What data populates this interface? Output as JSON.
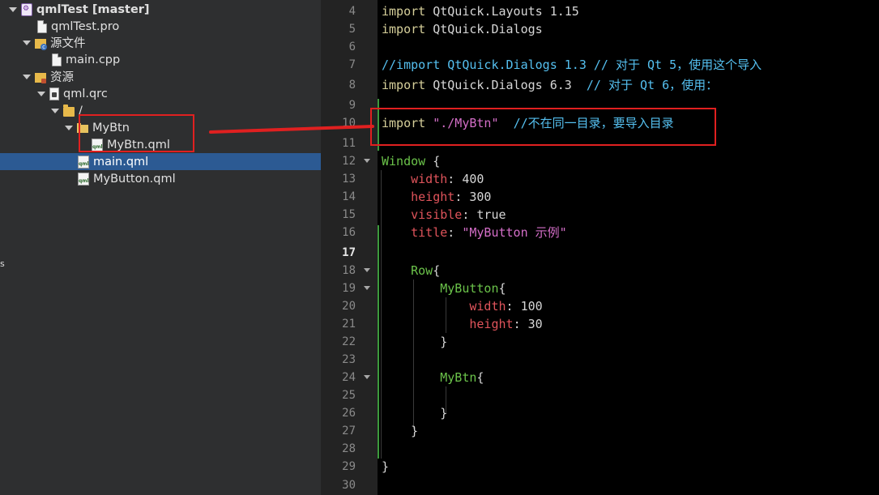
{
  "project_tree": {
    "items": [
      {
        "label": "qmlTest [master]",
        "icon": "project-icon",
        "expanded": true
      },
      {
        "label": "qmlTest.pro",
        "icon": "pro-file-icon"
      },
      {
        "label": "源文件",
        "icon": "sources-folder-icon",
        "expanded": true
      },
      {
        "label": "main.cpp",
        "icon": "cpp-file-icon"
      },
      {
        "label": "资源",
        "icon": "resources-folder-icon",
        "expanded": true
      },
      {
        "label": "qml.qrc",
        "icon": "qrc-file-icon",
        "expanded": true
      },
      {
        "label": "/",
        "icon": "folder-icon",
        "expanded": true
      },
      {
        "label": "MyBtn",
        "icon": "folder-icon",
        "expanded": true
      },
      {
        "label": "MyBtn.qml",
        "icon": "qml-file-icon"
      },
      {
        "label": "main.qml",
        "icon": "qml-file-icon",
        "selected": true
      },
      {
        "label": "MyButton.qml",
        "icon": "qml-file-icon"
      }
    ],
    "edge_text": "s"
  },
  "editor": {
    "current_line": 17,
    "lines": [
      {
        "n": "4",
        "code": "import QtQuick.Layouts 1.15"
      },
      {
        "n": "5",
        "code": "import QtQuick.Dialogs"
      },
      {
        "n": "6",
        "code": ""
      },
      {
        "n": "7",
        "code": "//import QtQuick.Dialogs 1.3 // 对于 Qt 5，使用这个导入"
      },
      {
        "n": "8",
        "code": "import QtQuick.Dialogs 6.3  // 对于 Qt 6，使用："
      },
      {
        "n": "9",
        "code": ""
      },
      {
        "n": "10",
        "code": "import \"./MyBtn\"  //不在同一目录，要导入目录"
      },
      {
        "n": "11",
        "code": ""
      },
      {
        "n": "12",
        "code": "Window {"
      },
      {
        "n": "13",
        "code": "    width: 400"
      },
      {
        "n": "14",
        "code": "    height: 300"
      },
      {
        "n": "15",
        "code": "    visible: true"
      },
      {
        "n": "16",
        "code": "    title: \"MyButton 示例\""
      },
      {
        "n": "17",
        "code": ""
      },
      {
        "n": "18",
        "code": "    Row{"
      },
      {
        "n": "19",
        "code": "        MyButton{"
      },
      {
        "n": "20",
        "code": "            width: 100"
      },
      {
        "n": "21",
        "code": "            height: 30"
      },
      {
        "n": "22",
        "code": "        }"
      },
      {
        "n": "23",
        "code": ""
      },
      {
        "n": "24",
        "code": "        MyBtn{"
      },
      {
        "n": "25",
        "code": ""
      },
      {
        "n": "26",
        "code": "        }"
      },
      {
        "n": "27",
        "code": "    }"
      },
      {
        "n": "28",
        "code": ""
      },
      {
        "n": "29",
        "code": "}"
      },
      {
        "n": "30",
        "code": ""
      }
    ],
    "tokens": {
      "l4": [
        "import",
        "QtQuick.Layouts",
        "1.15"
      ],
      "l5": [
        "import",
        "QtQuick.Dialogs"
      ],
      "l7": "//import QtQuick.Dialogs 1.3 // 对于 Qt 5，使用这个导入",
      "l8": [
        "import",
        "QtQuick.Dialogs",
        "6.3",
        "// 对于 Qt 6，使用："
      ],
      "l10": [
        "import",
        "\"./MyBtn\"",
        "//不在同一目录，要导入目录"
      ],
      "l12": [
        "Window",
        "{"
      ],
      "l13": [
        "width",
        ":",
        "400"
      ],
      "l14": [
        "height",
        ":",
        "300"
      ],
      "l15": [
        "visible",
        ":",
        "true"
      ],
      "l16": [
        "title",
        ":",
        "\"MyButton 示例\""
      ],
      "l18": [
        "Row",
        "{"
      ],
      "l19": [
        "MyButton",
        "{"
      ],
      "l20": [
        "width",
        ":",
        "100"
      ],
      "l21": [
        "height",
        ":",
        "30"
      ],
      "l22": "}",
      "l24": [
        "MyBtn",
        "{"
      ],
      "l26": "}",
      "l27": "}",
      "l29": "}"
    }
  },
  "colors": {
    "highlight_box": "#e02020",
    "selection": "#2c5a93",
    "keyword": "#d6cf9a",
    "comment": "#55c0f0",
    "type": "#6bc34a",
    "property": "#e0545b",
    "string": "#d46ec8"
  }
}
